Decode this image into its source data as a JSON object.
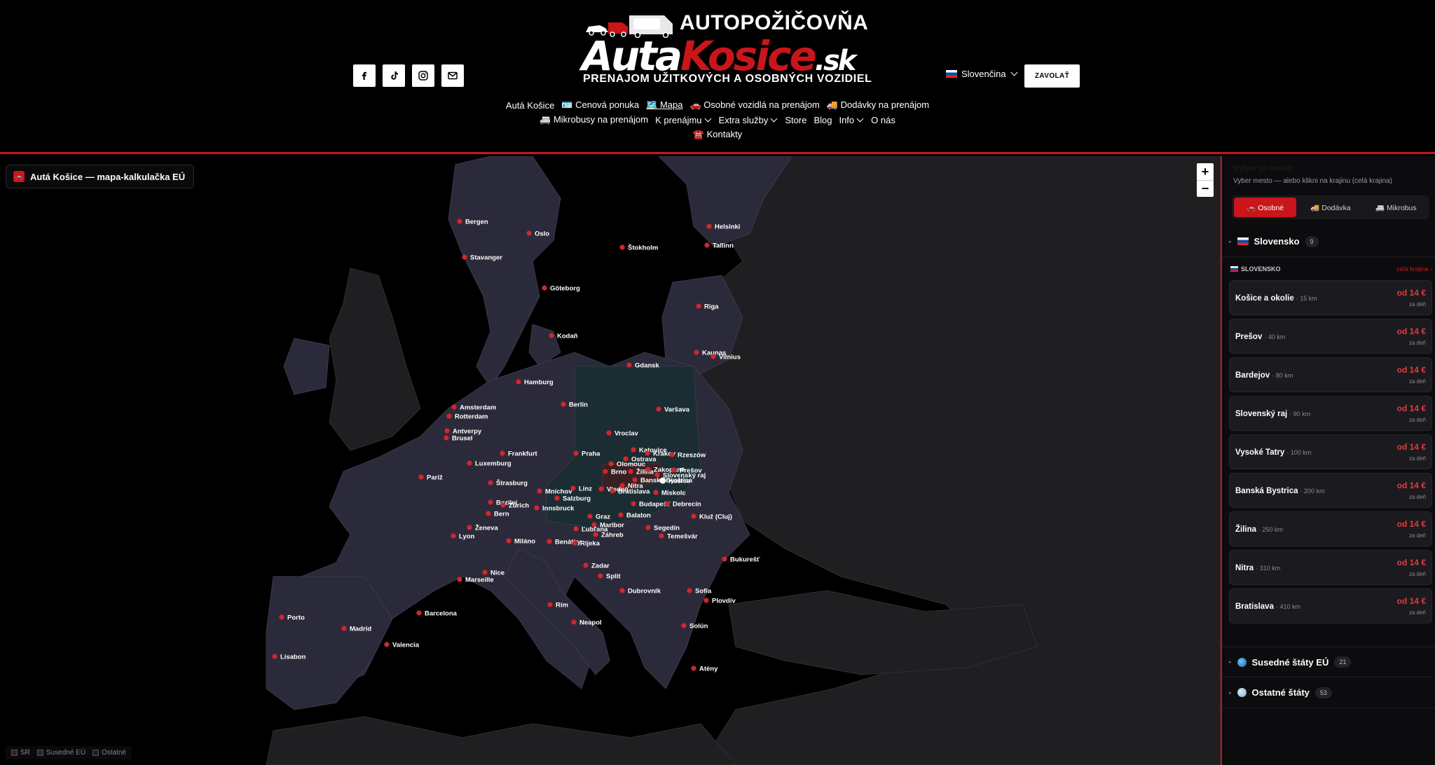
{
  "header": {
    "logo_top": "AUTOPOŽIČOVŇA",
    "logo_white": "Auta",
    "logo_red": "Kosice",
    "logo_sk": ".sk",
    "logo_sub": "PRENAJOM UŽITKOVÝCH A OSOBNÝCH VOZIDIEL",
    "language": "Slovenčina",
    "call_button": "ZAVOLAŤ",
    "nav_row1": [
      "Autá Košice",
      "🪪 Cenová ponuka",
      "🗺️ Mapa",
      "🚗 Osobné vozidlá na prenájom",
      "🚚 Dodávky na prenájom"
    ],
    "nav_row2": [
      "🚐 Mikrobusy na prenájom",
      "K prenájmu",
      "Extra služby",
      "Store",
      "Blog",
      "Info",
      "O nás"
    ],
    "nav_row3": [
      "☎️ Kontakty"
    ]
  },
  "map": {
    "title": "Autá Košice — mapa-kalkulačka EÚ",
    "zoom_in": "+",
    "zoom_out": "−",
    "legend": [
      "SR",
      "Susedné EÚ",
      "Ostatné"
    ],
    "cities": [
      "Bergen",
      "Oslo",
      "Helsinki",
      "Štokholm",
      "Tallinn",
      "Stavanger",
      "Göteborg",
      "Riga",
      "Kodaň",
      "Kaunas",
      "Vilnius",
      "Gdansk",
      "Hamburg",
      "Berlin",
      "Amsterdam",
      "Rotterdam",
      "Varšava",
      "Antverpy",
      "Brusel",
      "Vroclav",
      "Frankfurt",
      "Praha",
      "Katovice",
      "Krakov",
      "Rzeszów",
      "Ostrava",
      "Olomouc",
      "Luxemburg",
      "Brno",
      "Žilina",
      "Zakopané",
      "Prešov",
      "Paríž",
      "Štrasburg",
      "Banská Bystrica",
      "Slovenský raj",
      "Košice",
      "Linz",
      "Viedeň",
      "Nitra",
      "Bratislava",
      "Miskolc",
      "Mníchov",
      "Salzburg",
      "Bazilej",
      "Zürich",
      "Innsbruck",
      "Budapešť",
      "Debrecín",
      "Bern",
      "Graz",
      "Balaton",
      "Maribor",
      "Kluž (Cluj)",
      "Ženeva",
      "Ľubľana",
      "Segedín",
      "Lyon",
      "Záhreb",
      "Temešvár",
      "Miláno",
      "Benátky",
      "Rijeka",
      "Bukurešť",
      "Zadar",
      "Nice",
      "Split",
      "Marseille",
      "Dubrovník",
      "Sofia",
      "Plovdiv",
      "Rím",
      "Barcelona",
      "Porto",
      "Neapol",
      "Madrid",
      "Solún",
      "Valencia",
      "Lisabon",
      "Atény"
    ]
  },
  "sidebar": {
    "title": "Vyber si mesto",
    "subtitle": "Vyber mesto — alebo klikni na krajinu (celá krajina)",
    "tabs": [
      "🚗 Osobné",
      "🚚 Dodávka",
      "🚐 Mikrobus"
    ],
    "group_sk": {
      "label": "Slovensko",
      "count": "9"
    },
    "section": {
      "name": "SLOVENSKO",
      "all": "celá krajina ›"
    },
    "price_from": "od 14 €",
    "price_per": "za deň",
    "cities": [
      {
        "name": "Košice a okolie",
        "dist": "· 15 km"
      },
      {
        "name": "Prešov",
        "dist": "· 40 km"
      },
      {
        "name": "Bardejov",
        "dist": "· 80 km"
      },
      {
        "name": "Slovenský raj",
        "dist": "· 90 km"
      },
      {
        "name": "Vysoké Tatry",
        "dist": "· 100 km"
      },
      {
        "name": "Banská Bystrica",
        "dist": "· 200 km"
      },
      {
        "name": "Žilina",
        "dist": "· 250 km"
      },
      {
        "name": "Nitra",
        "dist": "· 310 km"
      },
      {
        "name": "Bratislava",
        "dist": "· 410 km"
      }
    ],
    "group_eu": {
      "label": "Susedné štáty EÚ",
      "count": "21"
    },
    "group_other": {
      "label": "Ostatné štáty",
      "count": "53"
    }
  },
  "colors": {
    "accent": "#c8161b",
    "land_eu": "#2b2a3a",
    "land_neighbor": "#1c2c33",
    "land_other": "#1f1f22",
    "water": "#000000"
  }
}
